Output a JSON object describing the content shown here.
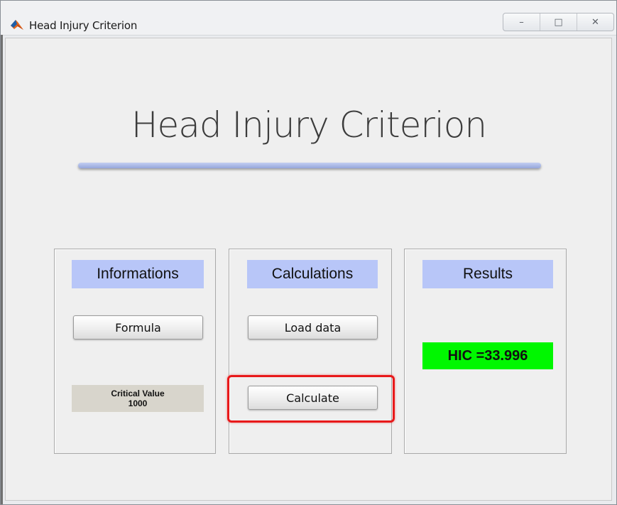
{
  "window": {
    "title": "Head Injury Criterion",
    "controls": {
      "minimize": "–",
      "maximize": "□",
      "close": "✕"
    }
  },
  "header": {
    "title": "Head Injury Criterion"
  },
  "panels": {
    "informations": {
      "title": "Informations",
      "formula_button": "Formula",
      "critical_label": "Critical Value",
      "critical_value": "1000"
    },
    "calculations": {
      "title": "Calculations",
      "load_button": "Load data",
      "calculate_button": "Calculate"
    },
    "results": {
      "title": "Results",
      "hic_text": "HIC =33.996"
    }
  },
  "icons": {
    "app": "matlab-icon"
  },
  "colors": {
    "panel_title_bg": "#b8c6f8",
    "result_bg": "#00f700",
    "highlight_border": "#e8191a",
    "critical_bg": "#d8d5cc"
  }
}
